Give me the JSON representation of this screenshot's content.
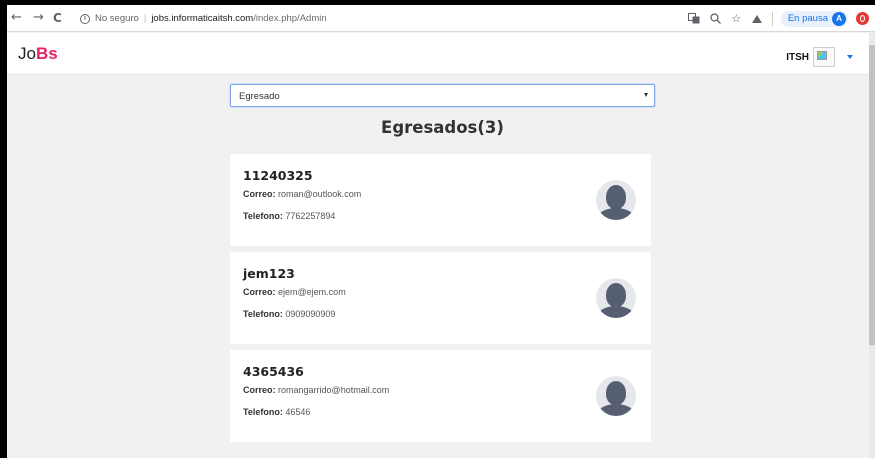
{
  "browser": {
    "back": "←",
    "forward": "→",
    "reload": "C",
    "security_label": "No seguro",
    "url_host": "jobs.informaticaitsh.com",
    "url_path": "/index.php/Admin",
    "pause_label": "En pausa",
    "profile_initial": "A"
  },
  "app": {
    "brand_prefix": "Jo",
    "brand_suffix": "Bs",
    "user_name": "ITSH"
  },
  "filter": {
    "selected": "Egresado"
  },
  "heading": "Egresados(3)",
  "labels": {
    "email": "Correo:",
    "phone": "Telefono:"
  },
  "graduates": [
    {
      "id": "11240325",
      "email": "roman@outlook.com",
      "phone": "7762257894"
    },
    {
      "id": "jem123",
      "email": "ejem@ejem.com",
      "phone": "0909090909"
    },
    {
      "id": "4365436",
      "email": "romangarrido@hotmail.com",
      "phone": "46546"
    }
  ],
  "colors": {
    "brand_accent": "#e91e63",
    "avatar": "#565e72",
    "page_background": "#f1f1f1"
  }
}
